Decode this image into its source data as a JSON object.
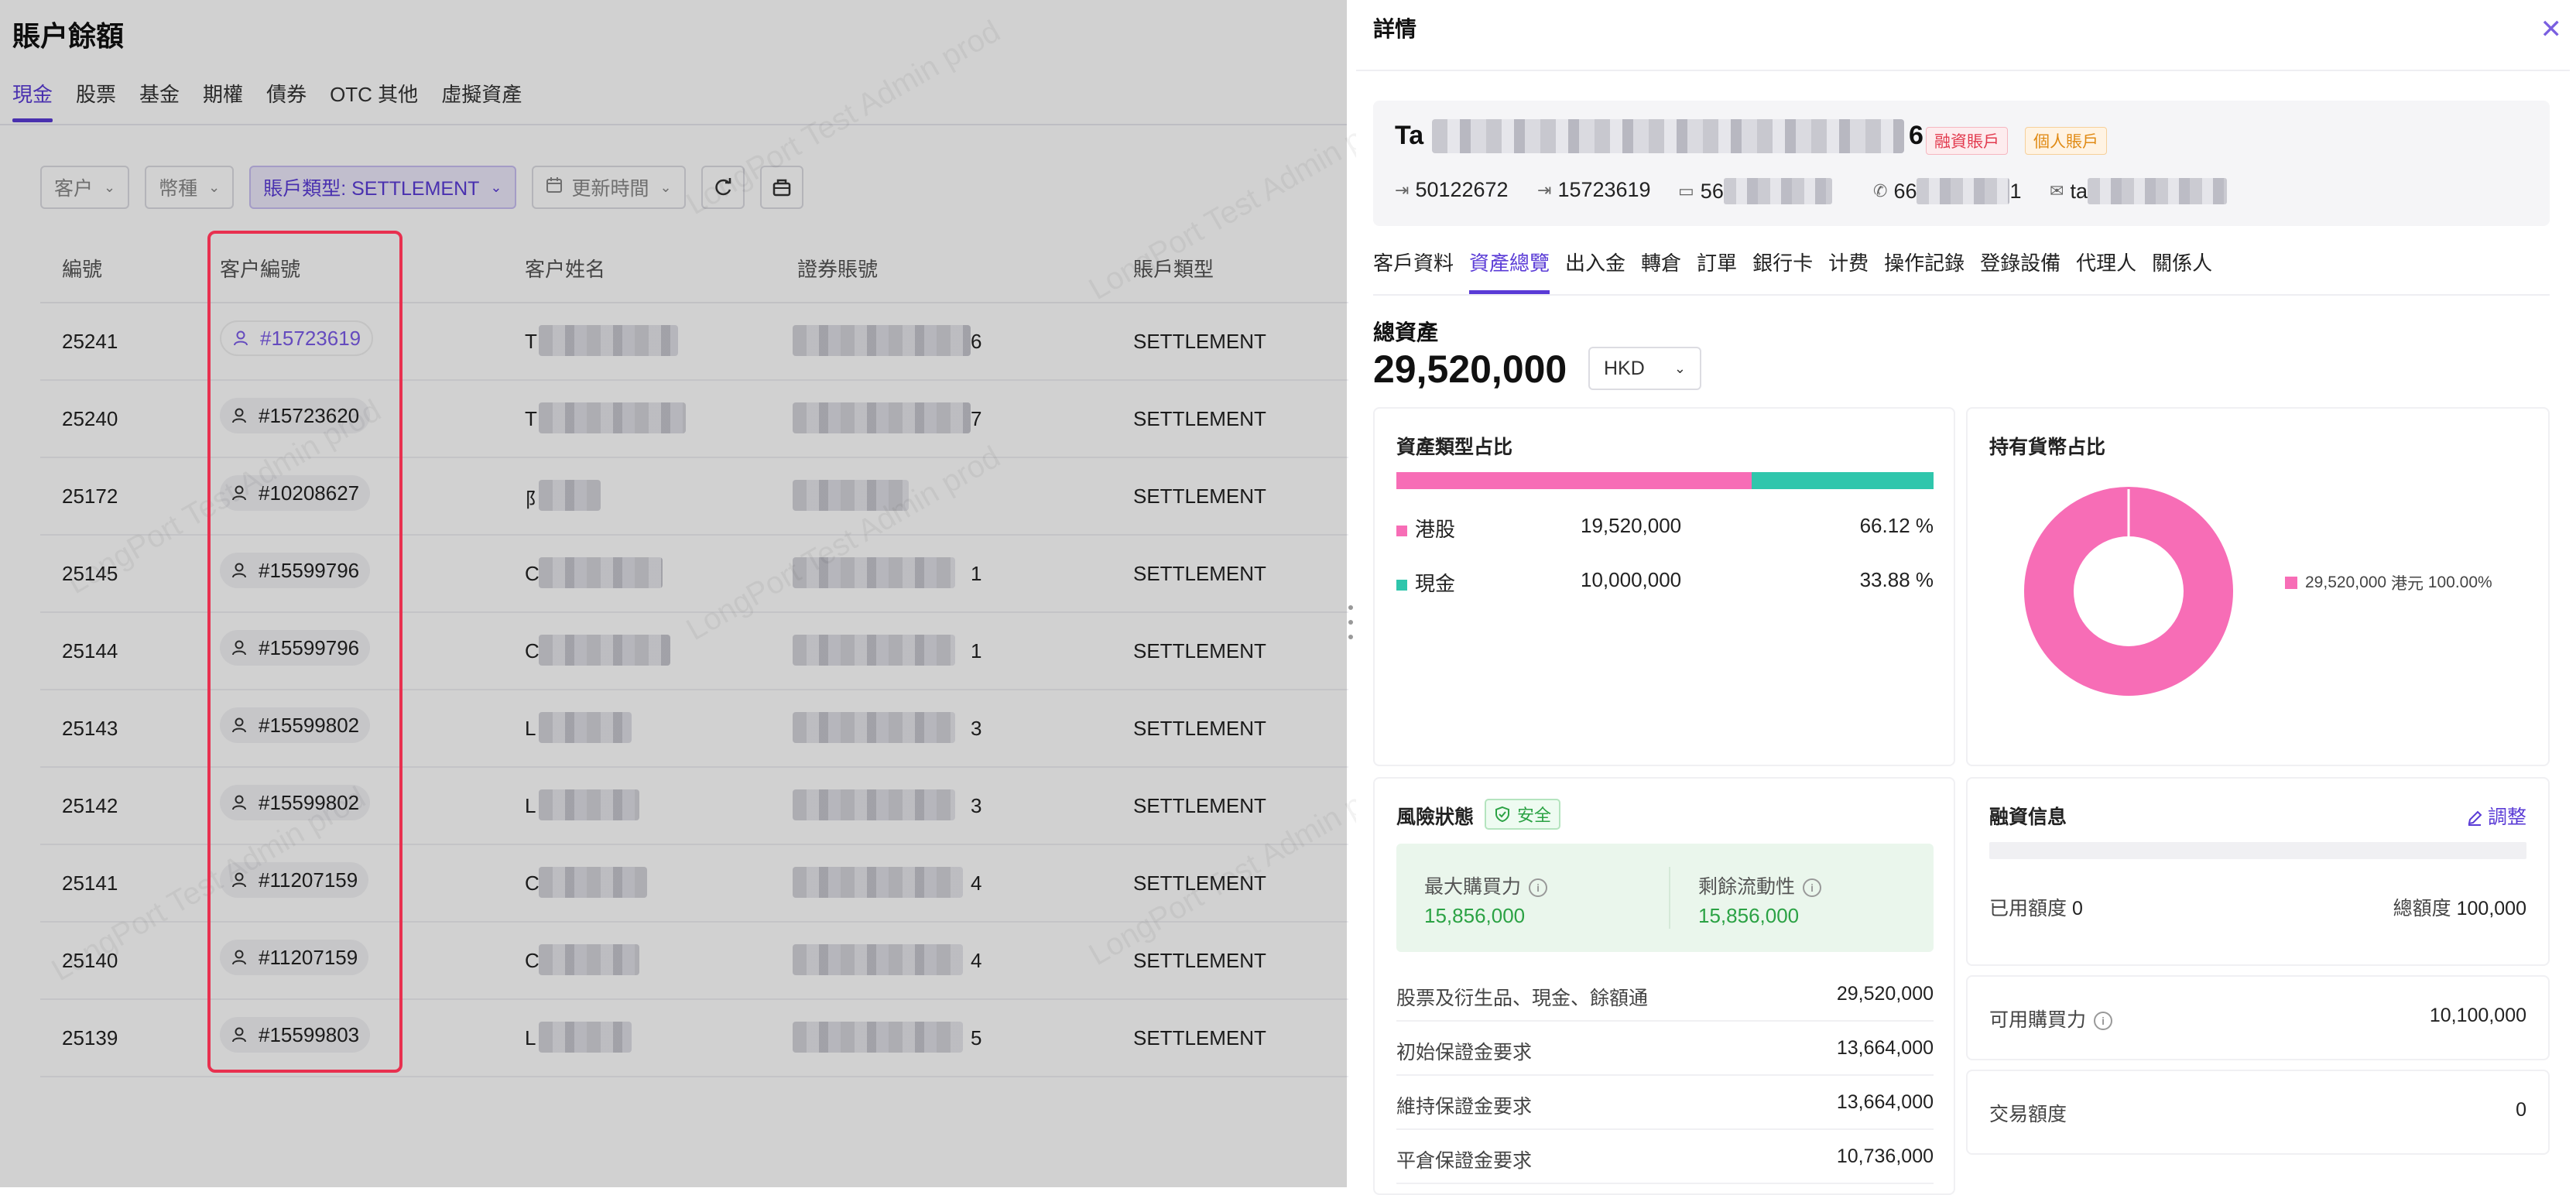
{
  "page": {
    "title": "賬户餘額",
    "tabs": [
      "現金",
      "股票",
      "基金",
      "期權",
      "債券",
      "OTC 其他",
      "虛擬資產"
    ],
    "active_tab": 0
  },
  "filters": {
    "customer": "客户",
    "currency": "幣種",
    "account_type": "賬戶類型: SETTLEMENT",
    "update_time": "更新時間"
  },
  "table": {
    "columns": [
      "編號",
      "客户編號",
      "客户姓名",
      "證券賬號",
      "賬戶類型"
    ],
    "rows": [
      {
        "id": "25241",
        "client": "#15723619",
        "name_tail": "T",
        "acct_tail": "6",
        "type": "SETTLEMENT"
      },
      {
        "id": "25240",
        "client": "#15723620",
        "name_tail": "T",
        "acct_tail": "7",
        "type": "SETTLEMENT"
      },
      {
        "id": "25172",
        "client": "#10208627",
        "name_tail": "阝",
        "acct_tail": "",
        "type": "SETTLEMENT"
      },
      {
        "id": "25145",
        "client": "#15599796",
        "name_tail": "C",
        "acct_tail": "1",
        "type": "SETTLEMENT"
      },
      {
        "id": "25144",
        "client": "#15599796",
        "name_tail": "C",
        "acct_tail": "1",
        "type": "SETTLEMENT"
      },
      {
        "id": "25143",
        "client": "#15599802",
        "name_tail": "L",
        "acct_tail": "3",
        "type": "SETTLEMENT"
      },
      {
        "id": "25142",
        "client": "#15599802",
        "name_tail": "L",
        "acct_tail": "3",
        "type": "SETTLEMENT"
      },
      {
        "id": "25141",
        "client": "#11207159",
        "name_tail": "C",
        "acct_tail": "4",
        "type": "SETTLEMENT"
      },
      {
        "id": "25140",
        "client": "#11207159",
        "name_tail": "C",
        "acct_tail": "4",
        "type": "SETTLEMENT"
      },
      {
        "id": "25139",
        "client": "#15599803",
        "name_tail": "L",
        "acct_tail": "5",
        "type": "SETTLEMENT"
      }
    ]
  },
  "drawer": {
    "title": "詳情",
    "close": "✕",
    "customer": {
      "name_prefix": "Ta",
      "name_suffix": "6",
      "badge_margin": "融資賬戶",
      "badge_personal": "個人賬戶",
      "id1": "50122672",
      "id2": "15723619",
      "id_card_prefix": "56",
      "phone_prefix": "66",
      "phone_suffix": "1",
      "email_prefix": "ta"
    },
    "tabs": [
      "客戶資料",
      "資產總覽",
      "出入金",
      "轉倉",
      "訂單",
      "銀行卡",
      "计费",
      "操作記錄",
      "登錄設備",
      "代理人",
      "關係人"
    ],
    "active_tab": 1,
    "total_assets_label": "總資產",
    "total_assets_value": "29,520,000",
    "currency": "HKD",
    "asset_type": {
      "title": "資產類型占比",
      "items": [
        {
          "name": "港股",
          "amount": "19,520,000",
          "pct": "66.12 %",
          "fraction": 0.6612,
          "color": "#f76db6"
        },
        {
          "name": "現金",
          "amount": "10,000,000",
          "pct": "33.88 %",
          "fraction": 0.3388,
          "color": "#2fc6ac"
        }
      ]
    },
    "currency_share": {
      "title": "持有貨幣占比",
      "amount": "29,520,000",
      "currency": "港元",
      "pct": "100.00%",
      "fraction": 1.0,
      "color": "#f76db6"
    },
    "risk": {
      "title": "風險狀態",
      "status": "安全",
      "max_buying_power_label": "最大購買力",
      "max_buying_power": "15,856,000",
      "remaining_liquidity_label": "剩餘流動性",
      "remaining_liquidity": "15,856,000",
      "rows": [
        {
          "k": "股票及衍生品、現金、餘額通",
          "v": "29,520,000"
        },
        {
          "k": "初始保證金要求",
          "v": "13,664,000"
        },
        {
          "k": "維持保證金要求",
          "v": "13,664,000"
        },
        {
          "k": "平倉保證金要求",
          "v": "10,736,000"
        }
      ]
    },
    "financing": {
      "title": "融資信息",
      "edit": "調整",
      "used_label": "已用額度",
      "used": "0",
      "total_label": "總額度",
      "total": "100,000",
      "used_fraction": 0,
      "available_label": "可用購買力",
      "available": "10,100,000",
      "trade_label": "交易額度",
      "trade": "0"
    }
  },
  "watermark": "LongPort Test Admin prod"
}
